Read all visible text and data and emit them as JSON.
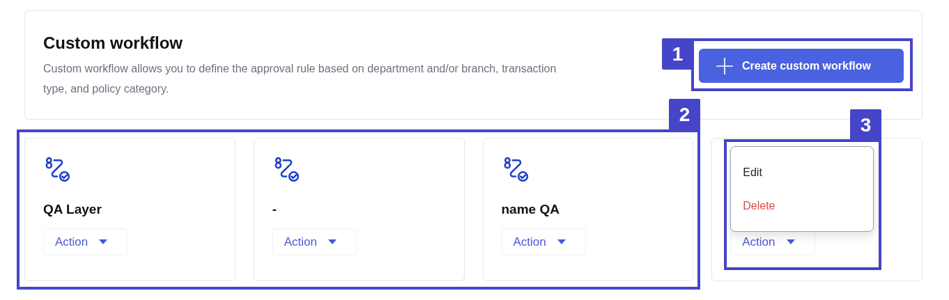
{
  "header": {
    "title": "Custom workflow",
    "description": "Custom workflow allows you to define the approval rule based on department and/or branch, transaction type, and policy category.",
    "create_button": "Create custom workflow"
  },
  "workflows": [
    {
      "name": "QA Layer",
      "action": "Action"
    },
    {
      "name": "-",
      "action": "Action"
    },
    {
      "name": "name QA",
      "action": "Action"
    },
    {
      "action": "Action",
      "menu_open": true
    }
  ],
  "action_menu": [
    {
      "label": "Edit",
      "kind": "normal"
    },
    {
      "label": "Delete",
      "kind": "danger"
    }
  ],
  "callouts": [
    {
      "label": "1"
    },
    {
      "label": "2"
    },
    {
      "label": "3"
    }
  ]
}
